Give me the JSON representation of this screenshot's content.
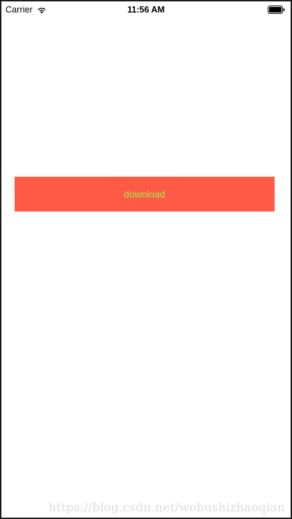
{
  "status_bar": {
    "carrier": "Carrier",
    "time": "11:56 AM",
    "wifi_icon": "wifi-icon",
    "battery_icon": "battery-icon"
  },
  "main": {
    "download_button": {
      "label": "download",
      "background_color": "#ff5a46",
      "text_color": "#a8e84a"
    }
  },
  "watermark": {
    "text": "https://blog.csdn.net/wobushizhaoqian"
  }
}
